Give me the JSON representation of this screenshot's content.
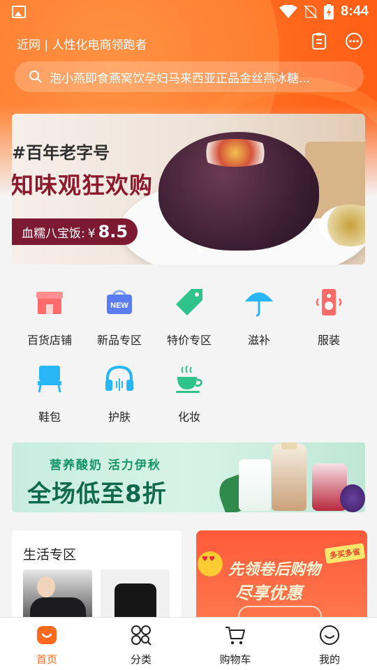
{
  "status_bar": {
    "time": "8:44"
  },
  "header": {
    "tagline": "近网 | 人性化电商领跑者"
  },
  "search": {
    "placeholder": "泡小燕即食燕窝饮孕妇马来西亚正品金丝燕冰糖..."
  },
  "banner": {
    "tag": "#百年老字号",
    "headline": "知味观狂欢购",
    "price_label": "血糯八宝饭:",
    "price_currency": "¥",
    "price_value": "8.5"
  },
  "categories": [
    {
      "label": "百货店铺",
      "icon": "store-icon"
    },
    {
      "label": "新品专区",
      "icon": "new-bag-icon"
    },
    {
      "label": "特价专区",
      "icon": "price-tag-icon"
    },
    {
      "label": "滋补",
      "icon": "umbrella-icon"
    },
    {
      "label": "服装",
      "icon": "speaker-icon"
    },
    {
      "label": "鞋包",
      "icon": "chair-icon"
    },
    {
      "label": "护肤",
      "icon": "headphones-icon"
    },
    {
      "label": "化妆",
      "icon": "teacup-icon"
    }
  ],
  "promo": {
    "subtitle": "营养酸奶  活力伊秋",
    "title": "全场低至8折"
  },
  "life_section": {
    "title": "生活专区"
  },
  "coupon": {
    "line1": "先领卷后购物",
    "line2": "尽享优惠",
    "badge": "多买多省"
  },
  "tabbar": [
    {
      "label": "首页",
      "icon": "home-icon",
      "active": true
    },
    {
      "label": "分类",
      "icon": "category-icon",
      "active": false
    },
    {
      "label": "购物车",
      "icon": "cart-icon",
      "active": false
    },
    {
      "label": "我的",
      "icon": "profile-icon",
      "active": false
    }
  ],
  "colors": {
    "accent": "#ff6a1e",
    "promo_green": "#10694c",
    "banner_red": "#8b1a2d"
  }
}
